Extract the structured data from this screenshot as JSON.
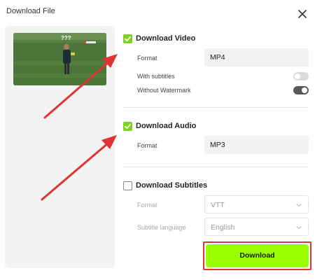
{
  "dialog": {
    "title": "Download File"
  },
  "video": {
    "checked": true,
    "title": "Download Video",
    "format_label": "Format",
    "format_value": "MP4",
    "subtitles_label": "With subtitles",
    "subtitles_on": false,
    "watermark_label": "Without Watermark",
    "watermark_on": true
  },
  "audio": {
    "checked": true,
    "title": "Download Audio",
    "format_label": "Format",
    "format_value": "MP3"
  },
  "subtitles": {
    "checked": false,
    "title": "Download Subtitles",
    "format_label": "Format",
    "format_value": "VTT",
    "language_label": "Subtitle language",
    "language_value": "English"
  },
  "actions": {
    "download_label": "Download"
  },
  "colors": {
    "accent": "#99ff00",
    "check": "#7ed321",
    "annotation": "#e03333"
  },
  "icons": [
    "close-icon",
    "check-icon",
    "chevron-down-icon"
  ]
}
